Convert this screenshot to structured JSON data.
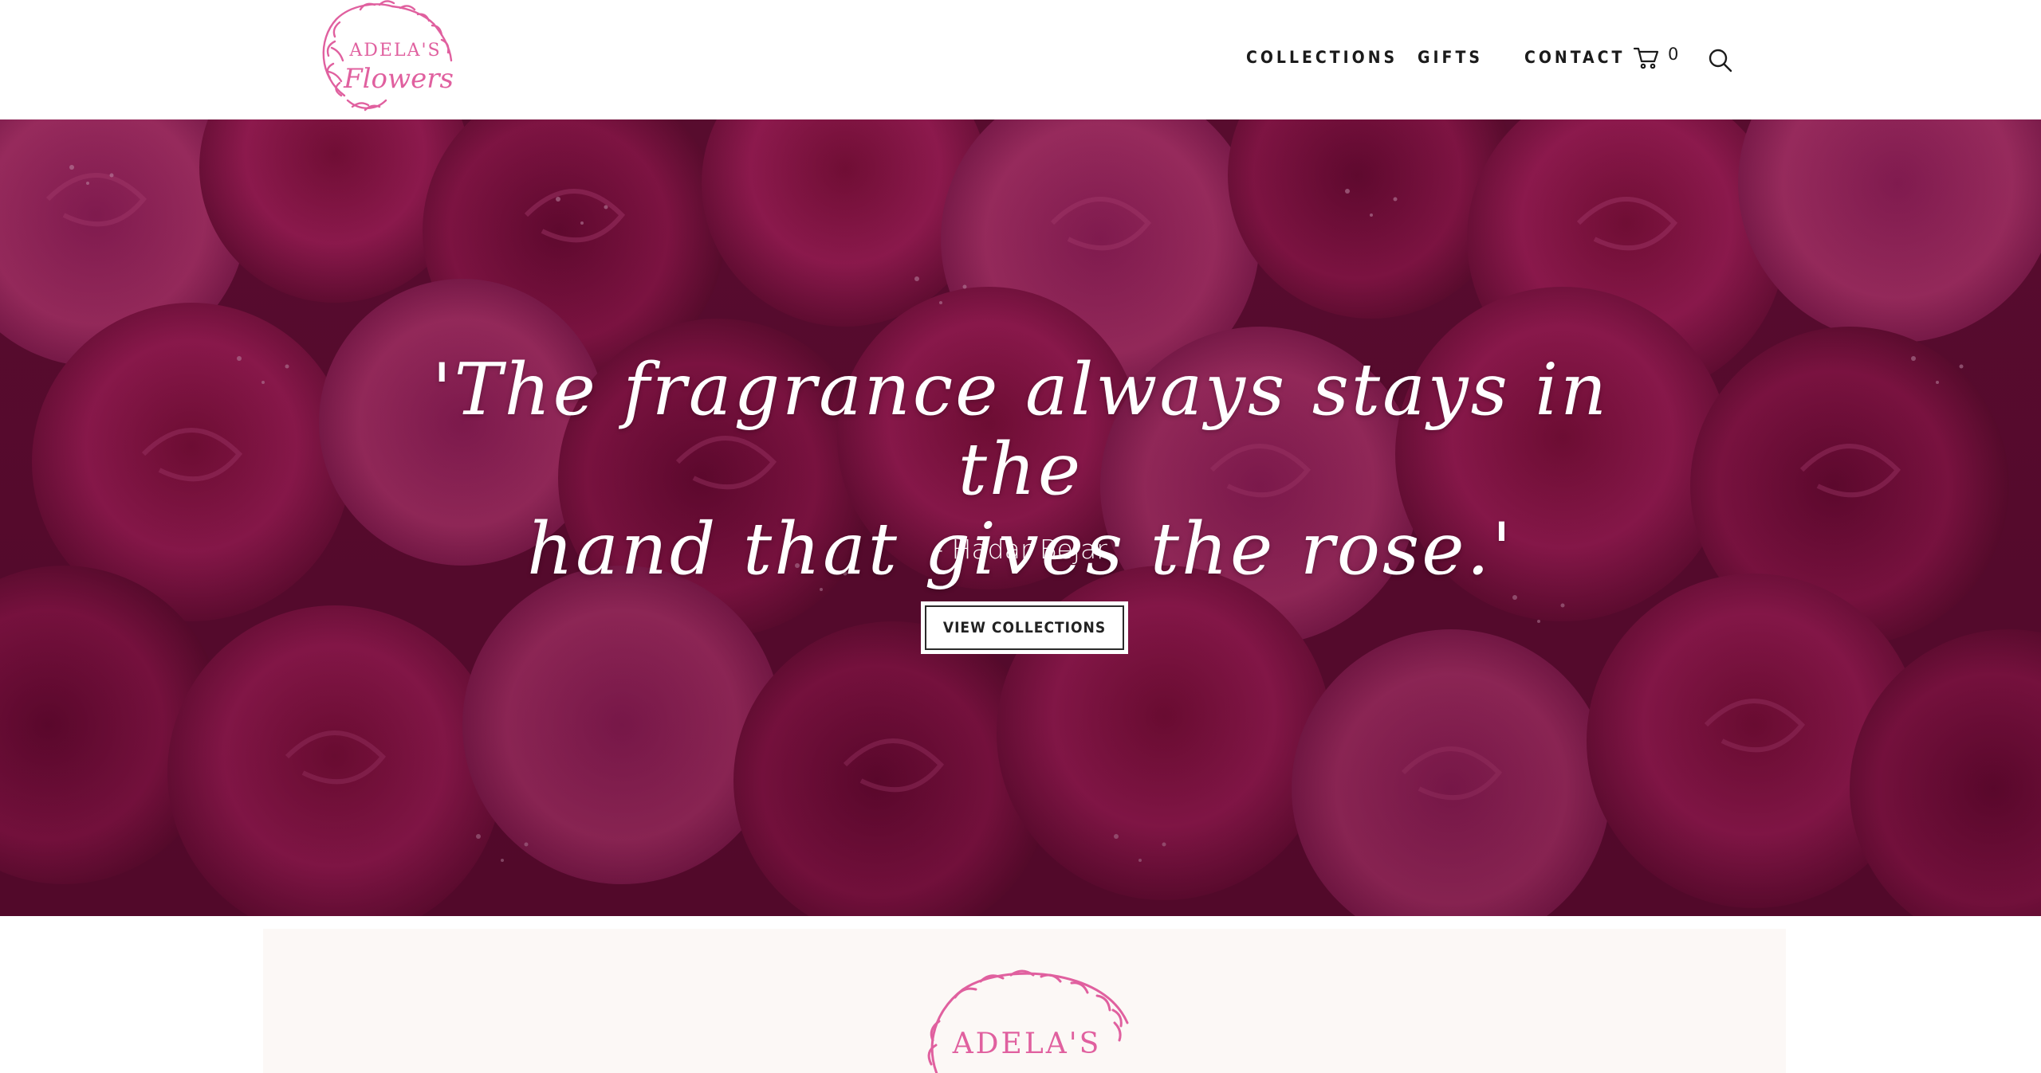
{
  "brand": {
    "logo_line1": "ADELA'S",
    "logo_line2": "Flowers",
    "accent_color": "#e0609f"
  },
  "nav": {
    "items": [
      {
        "label": "COLLECTIONS"
      },
      {
        "label": "GIFTS"
      },
      {
        "label": "CONTACT"
      }
    ],
    "cart_count": "0",
    "cart_icon": "cart-icon",
    "search_icon": "search-icon"
  },
  "hero": {
    "quote_line1": "'The fragrance always stays in the",
    "quote_line2": "hand that gives the rose.'",
    "author": "- Hadar Bejar",
    "cta_label": "VIEW COLLECTIONS"
  },
  "lower": {
    "logo_line1": "ADELA'S"
  }
}
